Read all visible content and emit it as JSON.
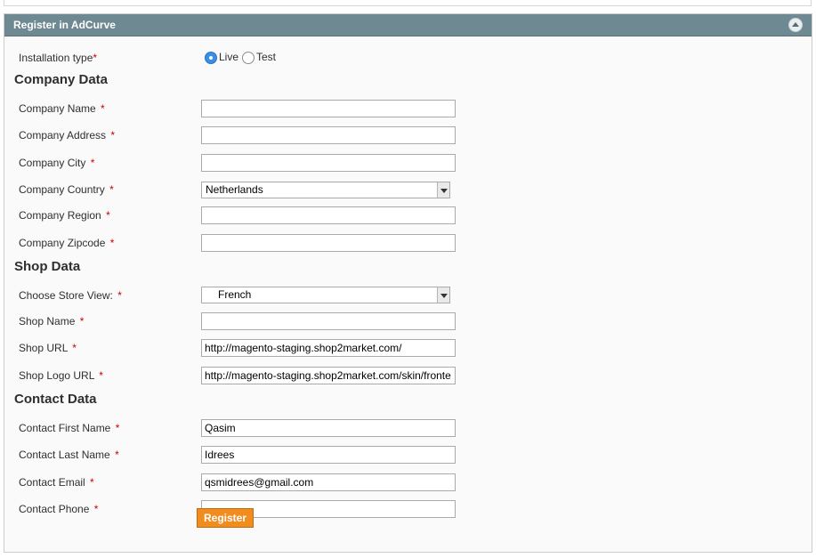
{
  "panel": {
    "title": "Register in AdCurve"
  },
  "installation": {
    "label": "Installation type",
    "options": [
      "Live",
      "Test"
    ],
    "selected": "Live"
  },
  "company": {
    "heading": "Company Data",
    "name_label": "Company Name",
    "address_label": "Company Address",
    "city_label": "Company City",
    "country_label": "Company Country",
    "country_value": "Netherlands",
    "region_label": "Company Region",
    "zipcode_label": "Company Zipcode"
  },
  "shop": {
    "heading": "Shop Data",
    "store_view_label": "Choose Store View:",
    "store_view_value": "French",
    "name_label": "Shop Name",
    "url_label": "Shop URL",
    "url_value": "http://magento-staging.shop2market.com/",
    "logo_label": "Shop Logo URL",
    "logo_value": "http://magento-staging.shop2market.com/skin/fronte"
  },
  "contact": {
    "heading": "Contact Data",
    "first_name_label": "Contact First Name",
    "first_name_value": "Qasim",
    "last_name_label": "Contact Last Name",
    "last_name_value": "Idrees",
    "email_label": "Contact Email",
    "email_value": "qsmidrees@gmail.com",
    "phone_label": "Contact Phone"
  },
  "required_marker": "*",
  "register_button": "Register",
  "colors": {
    "header": "#6f8992",
    "button": "#f18c1e",
    "required": "#cc0000",
    "radio_selected": "#3b8ee6"
  }
}
